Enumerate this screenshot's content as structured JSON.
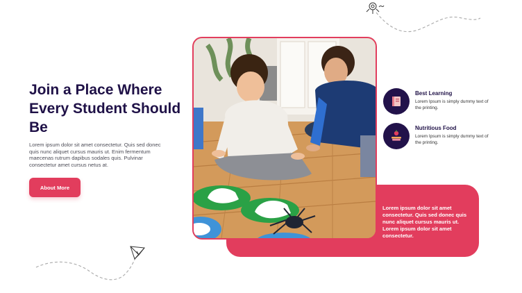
{
  "hero": {
    "title": "Join a Place Where Every Student Should Be",
    "description": "Lorem ipsum dolor sit amet consectetur. Quis sed donec quis nunc aliquet cursus mauris ut. Enim fermentum maecenas rutrum dapibus sodales quis. Pulvinar consectetur amet cursus netus at.",
    "button_label": "About More"
  },
  "features": [
    {
      "title": "Best Learning",
      "description": "Lorem Ipsum is simply dummy text of the printing.",
      "icon": "book-icon"
    },
    {
      "title": "Nutritious Food",
      "description": "Lorem Ipsum is simply dummy text of the printing.",
      "icon": "food-icon"
    }
  ],
  "pink_card": {
    "text": "Lorem ipsum dolor sit amet consectetur. Quis sed donec quis nunc aliquet cursus mauris ut. Lorem ipsum dolor sit amet consectetur."
  },
  "colors": {
    "accent": "#e23d5d",
    "heading": "#1f1147",
    "icon_bg": "#22124a"
  },
  "decorations": [
    "kite-icon",
    "paper-plane-icon",
    "dashed-path"
  ]
}
